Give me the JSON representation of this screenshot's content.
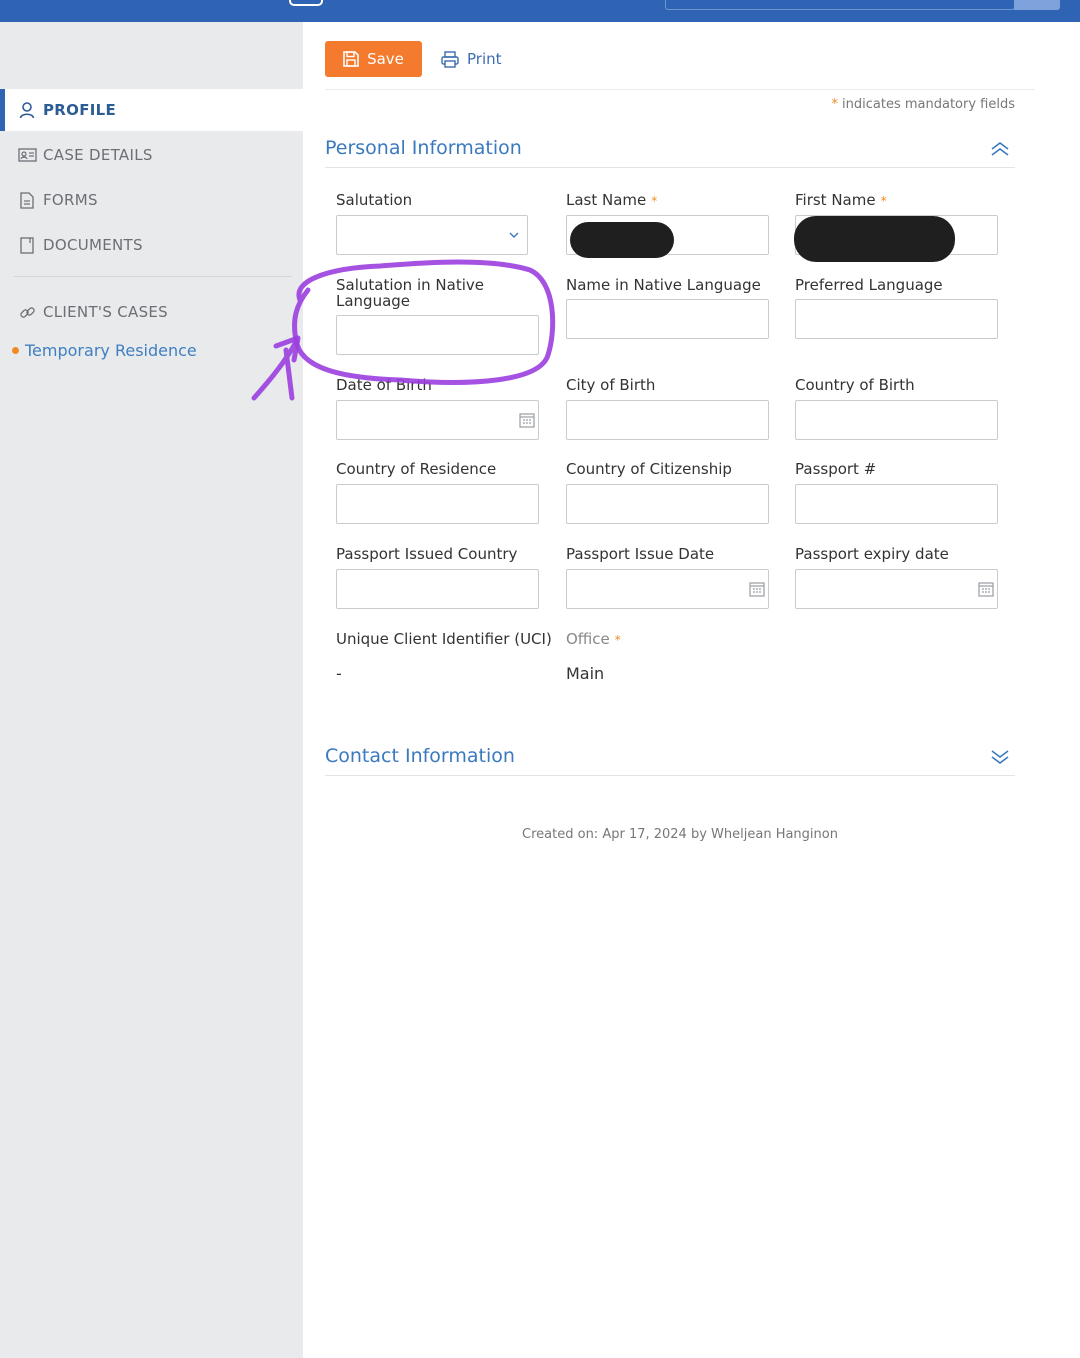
{
  "toolbar": {
    "save_label": "Save",
    "print_label": "Print"
  },
  "mandatory_note": "indicates mandatory fields",
  "sidebar": {
    "items": [
      {
        "label": "PROFILE",
        "icon": "user-icon"
      },
      {
        "label": "CASE DETAILS",
        "icon": "id-card-icon"
      },
      {
        "label": "FORMS",
        "icon": "form-document-icon"
      },
      {
        "label": "DOCUMENTS",
        "icon": "document-icon"
      },
      {
        "label": "CLIENT'S CASES",
        "icon": "link-icon"
      }
    ],
    "case_link": "Temporary Residence"
  },
  "personal": {
    "title": "Personal Information",
    "fields": {
      "salutation": "Salutation",
      "last_name": "Last Name",
      "first_name": "First Name",
      "salutation_native": "Salutation in Native Language",
      "name_native": "Name in Native Language",
      "preferred_language": "Preferred Language",
      "dob": "Date of Birth",
      "city_birth": "City of Birth",
      "country_birth": "Country of Birth",
      "country_residence": "Country of Residence",
      "country_citizenship": "Country of Citizenship",
      "passport_no": "Passport #",
      "passport_country": "Passport Issued Country",
      "passport_issue": "Passport Issue Date",
      "passport_expiry": "Passport expiry date",
      "uci": "Unique Client Identifier (UCI)",
      "office": "Office"
    },
    "values": {
      "uci": "-",
      "office": "Main"
    }
  },
  "contact": {
    "title": "Contact Information"
  },
  "footer": "Created on: Apr 17, 2024 by Wheljean Hanginon",
  "colors": {
    "topbar": "#2f63b4",
    "accent": "#f47a2d",
    "link": "#3a79c0",
    "annotation": "#9b3fe0"
  }
}
